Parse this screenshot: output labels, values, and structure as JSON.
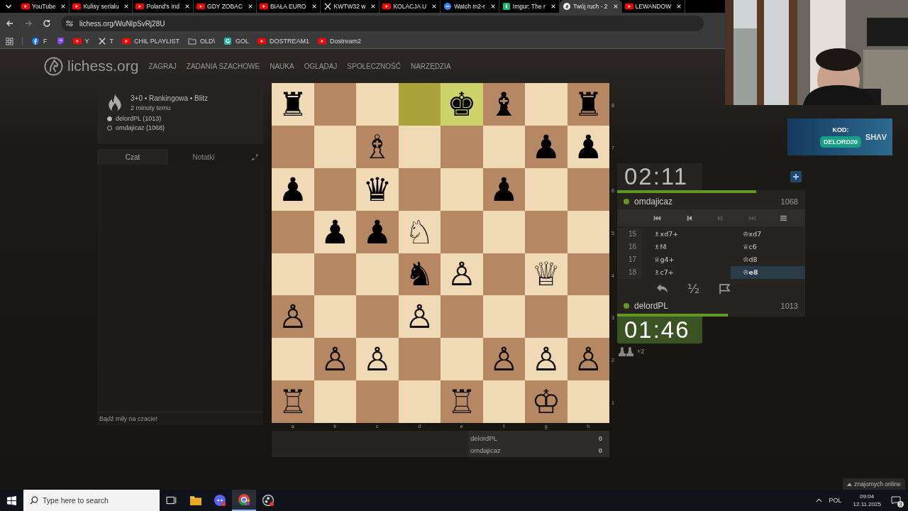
{
  "browser": {
    "tabs": [
      {
        "title": "YouTube",
        "kind": "youtube",
        "selected": false
      },
      {
        "title": "Kulisy serialu",
        "kind": "youtube",
        "selected": false
      },
      {
        "title": "Poland's Ind",
        "kind": "youtube",
        "selected": false
      },
      {
        "title": "GDY ZOBAC",
        "kind": "youtube",
        "selected": false
      },
      {
        "title": "BIAŁA EURO",
        "kind": "youtube",
        "selected": false
      },
      {
        "title": "KWTW32 w",
        "kind": "x",
        "selected": false
      },
      {
        "title": "KOLACJA U",
        "kind": "youtube",
        "selected": false
      },
      {
        "title": "Watch m2-r",
        "kind": "link",
        "selected": false
      },
      {
        "title": "Imgur: The r",
        "kind": "imgur",
        "selected": false
      },
      {
        "title": "Twój ruch - 2",
        "kind": "lichess",
        "selected": true
      },
      {
        "title": "LEWANDOW",
        "kind": "youtube",
        "selected": false
      }
    ],
    "url": "lichess.org/WuNIpSvRj28U",
    "bookmarks": [
      {
        "label": "F",
        "kind": "facebook"
      },
      {
        "kind": "twitch"
      },
      {
        "label": "Y",
        "kind": "youtube"
      },
      {
        "label": "T",
        "kind": "x"
      },
      {
        "label": "CHIL PLAYLIST",
        "kind": "youtube"
      },
      {
        "label": "OLD\\",
        "kind": "folder"
      },
      {
        "label": "GOL",
        "kind": "gol"
      },
      {
        "label": "DOSTREAM1",
        "kind": "youtube"
      },
      {
        "label": "Dostream2",
        "kind": "youtube"
      }
    ]
  },
  "site": {
    "logo": "lichess.org",
    "nav": [
      "ZAGRAJ",
      "ZADANIA SZACHOWE",
      "NAUKA",
      "OGLĄDAJ",
      "SPOŁECZNOŚĆ",
      "NARZĘDZIA"
    ]
  },
  "game": {
    "title": "3+0 • Rankingowa • Blitz",
    "time": "2 minuty temu",
    "players": [
      {
        "name": "delordPL (1013)",
        "kind": "white"
      },
      {
        "name": "omdajicaz (1068)",
        "kind": "black"
      }
    ]
  },
  "chat": {
    "tabs": [
      {
        "label": "Czat",
        "selected": true
      },
      {
        "label": "Notatki",
        "selected": false
      }
    ],
    "placeholder": "Bądź miły na czacie!"
  },
  "board": {
    "ranks": [
      [
        {
          "piece": "♜",
          "highlight": false
        },
        {
          "highlight": false
        },
        {
          "highlight": false
        },
        {
          "highlight": true
        },
        {
          "piece": "♚",
          "highlight": true
        },
        {
          "piece": "♝",
          "highlight": false
        },
        {
          "highlight": false
        },
        {
          "piece": "♜",
          "highlight": false
        }
      ],
      [
        {
          "highlight": false
        },
        {
          "highlight": false
        },
        {
          "piece": "♗",
          "highlight": false
        },
        {
          "highlight": false
        },
        {
          "highlight": false
        },
        {
          "highlight": false
        },
        {
          "piece": "♟",
          "highlight": false
        },
        {
          "piece": "♟",
          "highlight": false
        }
      ],
      [
        {
          "piece": "♟",
          "highlight": false
        },
        {
          "highlight": false
        },
        {
          "piece": "♛",
          "highlight": false
        },
        {
          "highlight": false
        },
        {
          "highlight": false
        },
        {
          "piece": "♟",
          "highlight": false
        },
        {
          "highlight": false
        },
        {
          "highlight": false
        }
      ],
      [
        {
          "highlight": false
        },
        {
          "piece": "♟",
          "highlight": false
        },
        {
          "piece": "♟",
          "highlight": false
        },
        {
          "piece": "♘",
          "highlight": false
        },
        {
          "highlight": false
        },
        {
          "highlight": false
        },
        {
          "highlight": false
        },
        {
          "highlight": false
        }
      ],
      [
        {
          "highlight": false
        },
        {
          "highlight": false
        },
        {
          "highlight": false
        },
        {
          "piece": "♞",
          "highlight": false
        },
        {
          "piece": "♙",
          "highlight": false
        },
        {
          "highlight": false
        },
        {
          "piece": "♕",
          "highlight": false
        },
        {
          "highlight": false
        }
      ],
      [
        {
          "piece": "♙",
          "highlight": false
        },
        {
          "highlight": false
        },
        {
          "highlight": false
        },
        {
          "piece": "♙",
          "highlight": false
        },
        {
          "highlight": false
        },
        {
          "highlight": false
        },
        {
          "highlight": false
        },
        {
          "highlight": false
        }
      ],
      [
        {
          "highlight": false
        },
        {
          "piece": "♙",
          "highlight": false
        },
        {
          "piece": "♙",
          "highlight": false
        },
        {
          "highlight": false
        },
        {
          "highlight": false
        },
        {
          "piece": "♙",
          "highlight": false
        },
        {
          "piece": "♙",
          "highlight": false
        },
        {
          "piece": "♙",
          "highlight": false
        }
      ],
      [
        {
          "piece": "♖",
          "highlight": false
        },
        {
          "highlight": false
        },
        {
          "highlight": false
        },
        {
          "highlight": false
        },
        {
          "piece": "♖",
          "highlight": false
        },
        {
          "highlight": false
        },
        {
          "piece": "♔",
          "highlight": false
        },
        {
          "highlight": false
        }
      ]
    ],
    "rank_labels": [
      "8",
      "7",
      "6",
      "5",
      "4",
      "3",
      "2",
      "1"
    ],
    "file_labels": [
      "a",
      "b",
      "c",
      "d",
      "e",
      "f",
      "g",
      "h"
    ]
  },
  "crosstable": [
    {
      "name": "delordPL",
      "score": "0"
    },
    {
      "name": "omdajicaz",
      "score": "0"
    }
  ],
  "opponent": {
    "clock": "02:11",
    "running": false,
    "level": 0.74,
    "name": "omdajicaz",
    "rating": "1068",
    "online": true
  },
  "move_nav": [
    {
      "kind": "first",
      "disabled": false
    },
    {
      "kind": "prev",
      "disabled": false
    },
    {
      "kind": "next",
      "disabled": true
    },
    {
      "kind": "last",
      "disabled": true
    },
    {
      "kind": "menu",
      "disabled": false
    }
  ],
  "moves": [
    {
      "number": "15",
      "white": {
        "san": "♗xd7+",
        "selected": false
      },
      "black": {
        "san": "♔xd7",
        "selected": false
      }
    },
    {
      "number": "16",
      "white": {
        "san": "♗f4",
        "selected": false
      },
      "black": {
        "san": "♕c6",
        "selected": false
      }
    },
    {
      "number": "17",
      "white": {
        "san": "♕g4+",
        "selected": false
      },
      "black": {
        "san": "♔d8",
        "selected": false
      }
    },
    {
      "number": "18",
      "white": {
        "san": "♗c7+",
        "selected": false
      },
      "black": {
        "san": "♔e8",
        "selected": true
      }
    }
  ],
  "actions": [
    {
      "kind": "takeback"
    },
    {
      "kind": "draw",
      "label": "½"
    },
    {
      "kind": "resign"
    }
  ],
  "player": {
    "name": "delordPL",
    "rating": "1013",
    "online": true,
    "level": 0.59,
    "clock": "01:46",
    "running": true,
    "material": "+2"
  },
  "sponsor": {
    "heading": "KOD:",
    "code": "DELORD20",
    "brand": "SHΛV"
  },
  "friends": "znajomych online",
  "taskbar": {
    "search_placeholder": "Type here to search",
    "apps": [
      {
        "kind": "taskview"
      },
      {
        "kind": "explorer"
      },
      {
        "kind": "discord"
      },
      {
        "kind": "chrome"
      },
      {
        "kind": "obs"
      }
    ],
    "language": "POL",
    "time": "09:04",
    "date": "12.11.2025",
    "notifications": "3"
  }
}
